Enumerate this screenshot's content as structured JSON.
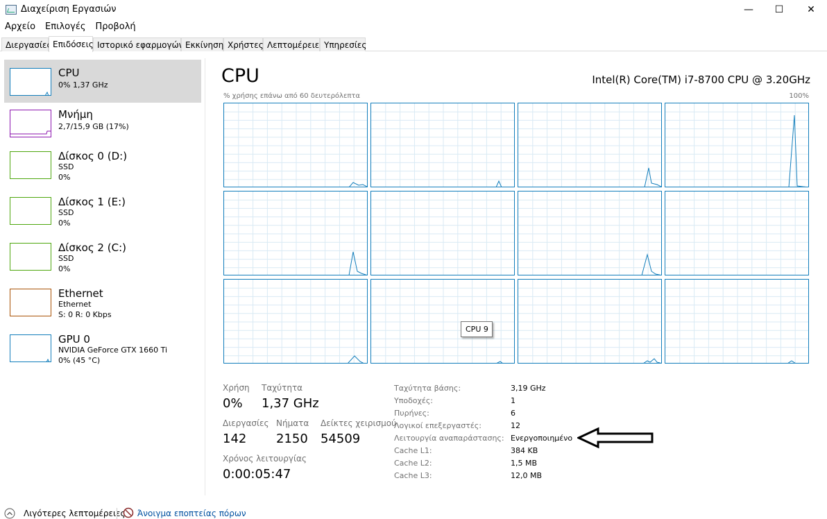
{
  "window": {
    "title": "Διαχείριση Εργασιών",
    "minimize": "—",
    "maximize": "☐",
    "close": "✕"
  },
  "menu": [
    "Αρχείο",
    "Επιλογές",
    "Προβολή"
  ],
  "tabs": [
    "Διεργασίες",
    "Επιδόσεις",
    "Ιστορικό εφαρμογών",
    "Εκκίνηση",
    "Χρήστες",
    "Λεπτομέρειες",
    "Υπηρεσίες"
  ],
  "active_tab": "Επιδόσεις",
  "sidebar": [
    {
      "title": "CPU",
      "lines": [
        "0% 1,37 GHz"
      ],
      "color": "#117dbb"
    },
    {
      "title": "Μνήμη",
      "lines": [
        "2,7/15,9 GB (17%)"
      ],
      "color": "#8b12ae"
    },
    {
      "title": "Δίσκος 0 (D:)",
      "lines": [
        "SSD",
        "0%"
      ],
      "color": "#4da60c"
    },
    {
      "title": "Δίσκος 1 (E:)",
      "lines": [
        "SSD",
        "0%"
      ],
      "color": "#4da60c"
    },
    {
      "title": "Δίσκος 2 (C:)",
      "lines": [
        "SSD",
        "0%"
      ],
      "color": "#4da60c"
    },
    {
      "title": "Ethernet",
      "lines": [
        "Ethernet",
        "S: 0 R: 0 Kbps"
      ],
      "color": "#a74f01"
    },
    {
      "title": "GPU 0",
      "lines": [
        "NVIDIA GeForce GTX 1660 Ti",
        "0% (45 °C)"
      ],
      "color": "#117dbb"
    }
  ],
  "main": {
    "title": "CPU",
    "model": "Intel(R) Core(TM) i7-8700 CPU @ 3.20GHz",
    "graph_caption": "% χρήσης επάνω από 60 δευτερόλεπτα",
    "graph_max": "100%",
    "tooltip": "CPU 9"
  },
  "stats": {
    "usage_label": "Χρήση",
    "usage_value": "0%",
    "speed_label": "Ταχύτητα",
    "speed_value": "1,37 GHz",
    "processes_label": "Διεργασίες",
    "processes_value": "142",
    "threads_label": "Νήματα",
    "threads_value": "2150",
    "handles_label": "Δείκτες χειρισμού",
    "handles_value": "54509",
    "uptime_label": "Χρόνος λειτουργίας",
    "uptime_value": "0:00:05:47"
  },
  "specs": [
    {
      "label": "Ταχύτητα βάσης:",
      "value": "3,19 GHz"
    },
    {
      "label": "Υποδοχές:",
      "value": "1"
    },
    {
      "label": "Πυρήνες:",
      "value": "6"
    },
    {
      "label": "Λογικοί επεξεργαστές:",
      "value": "12"
    },
    {
      "label": "Λειτουργία αναπαράστασης:",
      "value": "Ενεργοποιημένο"
    },
    {
      "label": "Cache L1:",
      "value": "384 KB"
    },
    {
      "label": "Cache L2:",
      "value": "1,5 MB"
    },
    {
      "label": "Cache L3:",
      "value": "12,0 MB"
    }
  ],
  "footer": {
    "less_details": "Λιγότερες λεπτομέρειες",
    "resource_monitor": "Άνοιγμα εποπτείας πόρων"
  }
}
